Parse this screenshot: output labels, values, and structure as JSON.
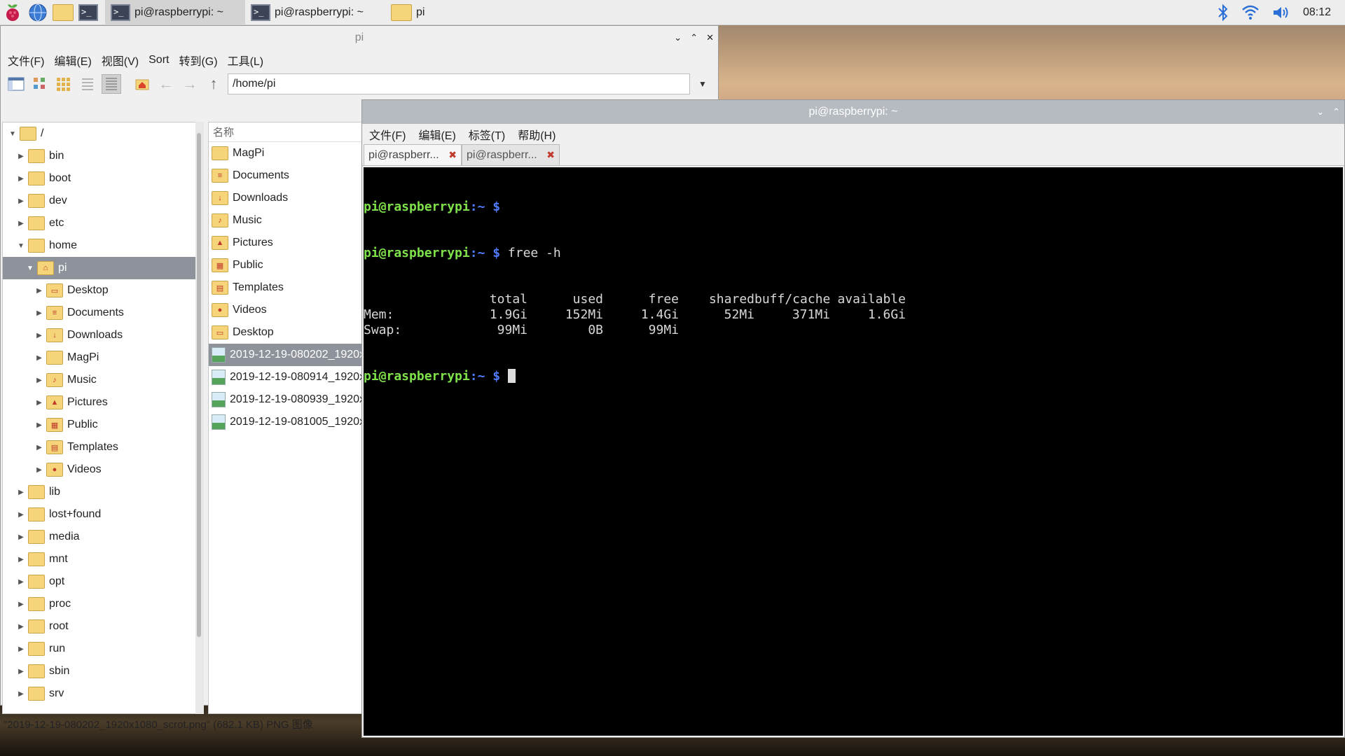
{
  "taskbar": {
    "tasks": [
      {
        "label": "pi@raspberrypi: ~",
        "icon": "terminal-icon"
      },
      {
        "label": "pi@raspberrypi: ~",
        "icon": "terminal-icon"
      },
      {
        "label": "pi",
        "icon": "folder-icon"
      }
    ],
    "clock": "08:12"
  },
  "file_manager": {
    "title": "pi",
    "menu": [
      "文件(F)",
      "编辑(E)",
      "视图(V)",
      "Sort",
      "转到(G)",
      "工具(L)"
    ],
    "path": "/home/pi",
    "tree": [
      {
        "label": "/",
        "arrow": "▼"
      },
      {
        "label": "bin",
        "arrow": "▶"
      },
      {
        "label": "boot",
        "arrow": "▶"
      },
      {
        "label": "dev",
        "arrow": "▶"
      },
      {
        "label": "etc",
        "arrow": "▶"
      },
      {
        "label": "home",
        "arrow": "▼"
      },
      {
        "label": "pi",
        "arrow": "▼"
      },
      {
        "label": "Desktop",
        "arrow": "▶"
      },
      {
        "label": "Documents",
        "arrow": "▶"
      },
      {
        "label": "Downloads",
        "arrow": "▶"
      },
      {
        "label": "MagPi",
        "arrow": "▶"
      },
      {
        "label": "Music",
        "arrow": "▶"
      },
      {
        "label": "Pictures",
        "arrow": "▶"
      },
      {
        "label": "Public",
        "arrow": "▶"
      },
      {
        "label": "Templates",
        "arrow": "▶"
      },
      {
        "label": "Videos",
        "arrow": "▶"
      },
      {
        "label": "lib",
        "arrow": "▶"
      },
      {
        "label": "lost+found",
        "arrow": "▶"
      },
      {
        "label": "media",
        "arrow": "▶"
      },
      {
        "label": "mnt",
        "arrow": "▶"
      },
      {
        "label": "opt",
        "arrow": "▶"
      },
      {
        "label": "proc",
        "arrow": "▶"
      },
      {
        "label": "root",
        "arrow": "▶"
      },
      {
        "label": "run",
        "arrow": "▶"
      },
      {
        "label": "sbin",
        "arrow": "▶"
      },
      {
        "label": "srv",
        "arrow": "▶"
      }
    ],
    "list_header": "名称",
    "files": [
      "MagPi",
      "Documents",
      "Downloads",
      "Music",
      "Pictures",
      "Public",
      "Templates",
      "Videos",
      "Desktop",
      "2019-12-19-080202_1920x",
      "2019-12-19-080914_1920x",
      "2019-12-19-080939_1920x",
      "2019-12-19-081005_1920x"
    ],
    "status": "\"2019-12-19-080202_1920x1080_scrot.png\" (682.1 KB) PNG 图像"
  },
  "terminal": {
    "title": "pi@raspberrypi: ~",
    "menu": [
      "文件(F)",
      "编辑(E)",
      "标签(T)",
      "帮助(H)"
    ],
    "tabs": [
      "pi@raspberr...",
      "pi@raspberr..."
    ],
    "prompt_user": "pi@raspberrypi",
    "prompt_sep": ":",
    "prompt_dir": "~ $",
    "command": " free -h",
    "mem_table": {
      "headers": [
        "",
        "total",
        "used",
        "free",
        "shared",
        "buff/cache",
        "available"
      ],
      "rows": [
        [
          "Mem:",
          "1.9Gi",
          "152Mi",
          "1.4Gi",
          "52Mi",
          "371Mi",
          "1.6Gi"
        ],
        [
          "Swap:",
          "99Mi",
          "0B",
          "99Mi",
          "",
          "",
          ""
        ]
      ]
    }
  }
}
